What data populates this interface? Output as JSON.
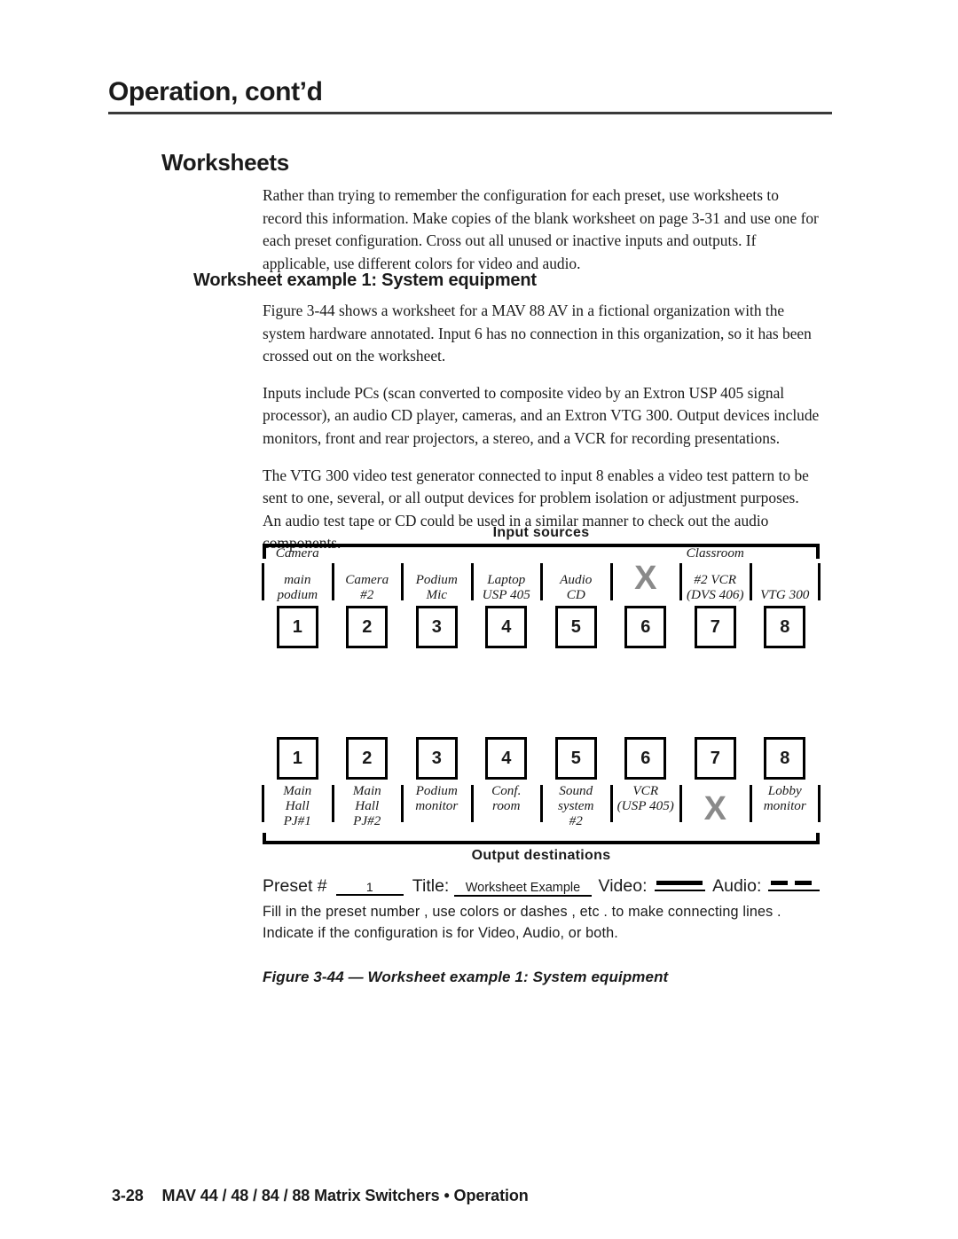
{
  "header": {
    "running_title": "Operation, cont’d"
  },
  "sections": {
    "h1": "Worksheets",
    "h2": "Worksheet example 1: System equipment"
  },
  "paragraphs": [
    "Rather than trying to remember the configuration for each preset, use worksheets to record this information.  Make copies of the blank worksheet on page 3-31 and use one for each preset configuration.  Cross out all unused or inactive inputs and outputs.  If applicable, use different colors for video and audio.",
    "Figure 3-44 shows a worksheet for a MAV 88 AV in a fictional organization with the system hardware annotated.  Input 6 has no connection in this organization, so it has been crossed out on the worksheet.",
    "Inputs include PCs (scan converted to composite video by an Extron USP 405 signal processor), an audio CD player, cameras, and an Extron VTG 300.  Output devices include monitors, front and rear projectors, a stereo, and a VCR for recording presentations.",
    "The VTG 300 video test generator connected to input 8 enables a video test pattern to be sent to one, several, or all output devices for problem isolation or adjustment purposes.  An audio test tape or CD could be used in a similar manner to check out the audio components."
  ],
  "worksheet": {
    "input_heading": "Input  sources",
    "output_heading": "Output destinations",
    "inputs": [
      {
        "number": "1",
        "lines": [
          "Camera",
          "main",
          "podium"
        ],
        "crossed_out": false
      },
      {
        "number": "2",
        "lines": [
          "Camera",
          "#2"
        ],
        "crossed_out": false
      },
      {
        "number": "3",
        "lines": [
          "Podium",
          "Mic"
        ],
        "crossed_out": false
      },
      {
        "number": "4",
        "lines": [
          "Laptop",
          "USP 405"
        ],
        "crossed_out": false
      },
      {
        "number": "5",
        "lines": [
          "Audio",
          "CD"
        ],
        "crossed_out": false
      },
      {
        "number": "6",
        "lines": [],
        "crossed_out": true
      },
      {
        "number": "7",
        "lines": [
          "Classroom",
          "#2 VCR",
          "(DVS 406)"
        ],
        "crossed_out": false
      },
      {
        "number": "8",
        "lines": [
          "VTG 300"
        ],
        "crossed_out": false
      }
    ],
    "outputs": [
      {
        "number": "1",
        "lines": [
          "Main",
          "Hall",
          "PJ#1"
        ],
        "crossed_out": false
      },
      {
        "number": "2",
        "lines": [
          "Main",
          "Hall",
          "PJ#2"
        ],
        "crossed_out": false
      },
      {
        "number": "3",
        "lines": [
          "Podium",
          "monitor"
        ],
        "crossed_out": false
      },
      {
        "number": "4",
        "lines": [
          "Conf.",
          "room"
        ],
        "crossed_out": false
      },
      {
        "number": "5",
        "lines": [
          "Sound",
          "system",
          "#2"
        ],
        "crossed_out": false
      },
      {
        "number": "6",
        "lines": [
          "VCR",
          "(USP 405)"
        ],
        "crossed_out": false
      },
      {
        "number": "7",
        "lines": [],
        "crossed_out": true
      },
      {
        "number": "8",
        "lines": [
          "Lobby",
          "monitor"
        ],
        "crossed_out": false
      }
    ],
    "crossout_glyph": "X",
    "crossout_color": "#8a8a8a",
    "form": {
      "preset_label": "Preset #",
      "preset_value": "1",
      "title_label": "Title:",
      "title_value": "Worksheet Example",
      "video_label": "Video:",
      "video_style": "solid-line",
      "audio_label": "Audio:",
      "audio_style": "dashed-line"
    },
    "instructions": [
      "Fill in the  preset number ,  use colors or dashes ,  etc . to make connecting lines .",
      "Indicate if the configuration is for Video, Audio, or both."
    ],
    "figure_caption": "Figure 3-44 — Worksheet example 1: System equipment"
  },
  "footer": {
    "page_number": "3-28",
    "document_title": "MAV 44 / 48 / 84 / 88 Matrix Switchers • Operation"
  }
}
